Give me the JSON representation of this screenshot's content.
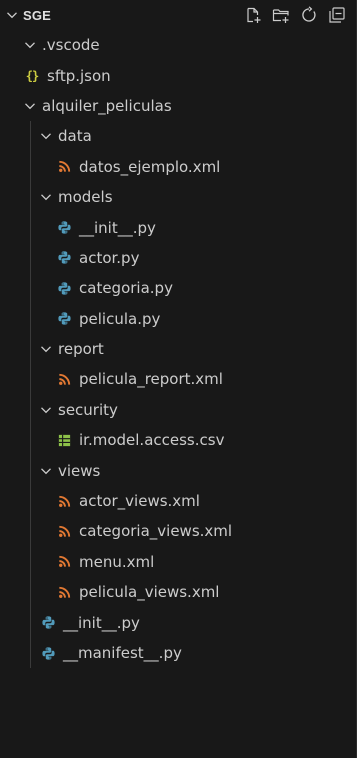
{
  "header": {
    "title": "SGE"
  },
  "colors": {
    "xml": "#e37933",
    "python": "#519aba",
    "json": "#cbcb41",
    "csv": "#8dc149"
  },
  "tree": [
    {
      "label": ".vscode",
      "type": "folder",
      "depth": 1,
      "icon": "chevron-down-icon"
    },
    {
      "label": "sftp.json",
      "type": "json",
      "depth": 1,
      "icon": "json-file-icon"
    },
    {
      "label": "alquiler_peliculas",
      "type": "folder",
      "depth": 1,
      "icon": "chevron-down-icon"
    },
    {
      "label": "data",
      "type": "folder",
      "depth": 2,
      "icon": "chevron-down-icon"
    },
    {
      "label": "datos_ejemplo.xml",
      "type": "xml",
      "depth": 3,
      "icon": "rss-xml-icon"
    },
    {
      "label": "models",
      "type": "folder",
      "depth": 2,
      "icon": "chevron-down-icon"
    },
    {
      "label": "__init__.py",
      "type": "python",
      "depth": 3,
      "icon": "python-file-icon"
    },
    {
      "label": "actor.py",
      "type": "python",
      "depth": 3,
      "icon": "python-file-icon"
    },
    {
      "label": "categoria.py",
      "type": "python",
      "depth": 3,
      "icon": "python-file-icon"
    },
    {
      "label": "pelicula.py",
      "type": "python",
      "depth": 3,
      "icon": "python-file-icon"
    },
    {
      "label": "report",
      "type": "folder",
      "depth": 2,
      "icon": "chevron-down-icon"
    },
    {
      "label": "pelicula_report.xml",
      "type": "xml",
      "depth": 3,
      "icon": "rss-xml-icon"
    },
    {
      "label": "security",
      "type": "folder",
      "depth": 2,
      "icon": "chevron-down-icon"
    },
    {
      "label": "ir.model.access.csv",
      "type": "csv",
      "depth": 3,
      "icon": "table-csv-icon"
    },
    {
      "label": "views",
      "type": "folder",
      "depth": 2,
      "icon": "chevron-down-icon"
    },
    {
      "label": "actor_views.xml",
      "type": "xml",
      "depth": 3,
      "icon": "rss-xml-icon"
    },
    {
      "label": "categoria_views.xml",
      "type": "xml",
      "depth": 3,
      "icon": "rss-xml-icon"
    },
    {
      "label": "menu.xml",
      "type": "xml",
      "depth": 3,
      "icon": "rss-xml-icon"
    },
    {
      "label": "pelicula_views.xml",
      "type": "xml",
      "depth": 3,
      "icon": "rss-xml-icon"
    },
    {
      "label": "__init__.py",
      "type": "python",
      "depth": 2,
      "icon": "python-file-icon"
    },
    {
      "label": "__manifest__.py",
      "type": "python",
      "depth": 2,
      "icon": "python-file-icon"
    }
  ]
}
